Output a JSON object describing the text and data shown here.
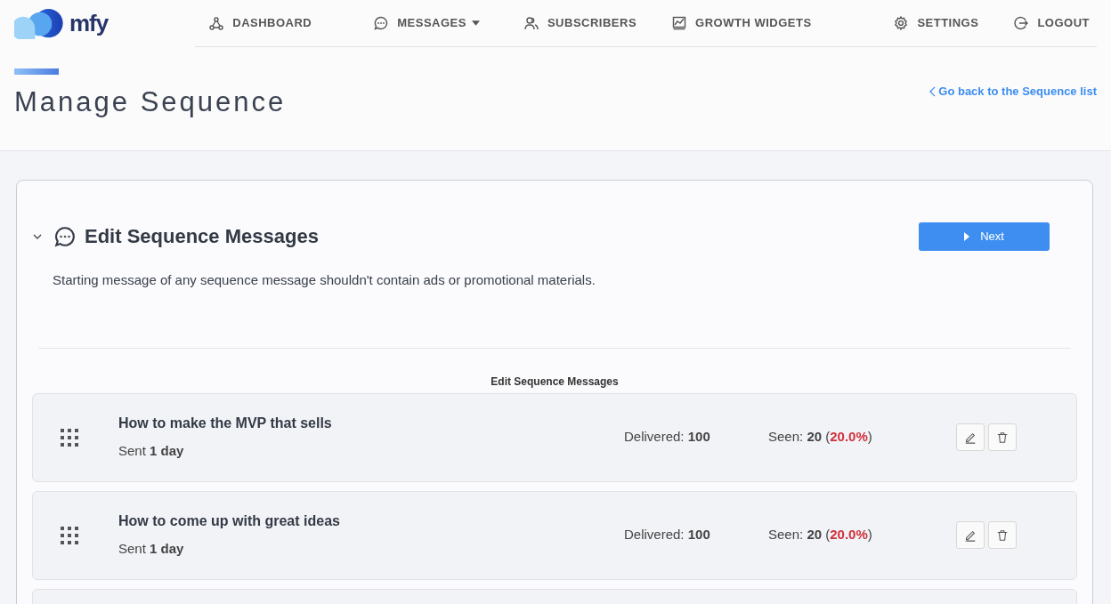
{
  "logo": {
    "text": "mfy"
  },
  "nav": [
    {
      "label": "DASHBOARD",
      "dropdown": false
    },
    {
      "label": "MESSAGES",
      "dropdown": true
    },
    {
      "label": "SUBSCRIBERS",
      "dropdown": false
    },
    {
      "label": "GROWTH WIDGETS",
      "dropdown": false
    }
  ],
  "nav_right": [
    {
      "label": "SETTINGS"
    },
    {
      "label": "LOGOUT"
    }
  ],
  "page": {
    "title": "Manage Sequence",
    "back_link": "Go back to the Sequence list"
  },
  "section": {
    "title": "Edit Sequence Messages",
    "expanded": true,
    "next_button": "Next",
    "note": "Starting message of any sequence message shouldn't contain ads or promotional materials.",
    "list_title": "Edit Sequence Messages"
  },
  "messages": [
    {
      "title": "How to make the MVP that sells",
      "sent": "Sent **1 day**",
      "delivered": "Delivered: **100**",
      "seen": "Seen: **20** (**20.0%**)"
    },
    {
      "title": "How to come up with great ideas",
      "sent": "Sent **1 day**",
      "delivered": "Delivered: **100**",
      "seen": "Seen: **20** (**20.0%**)"
    }
  ]
}
